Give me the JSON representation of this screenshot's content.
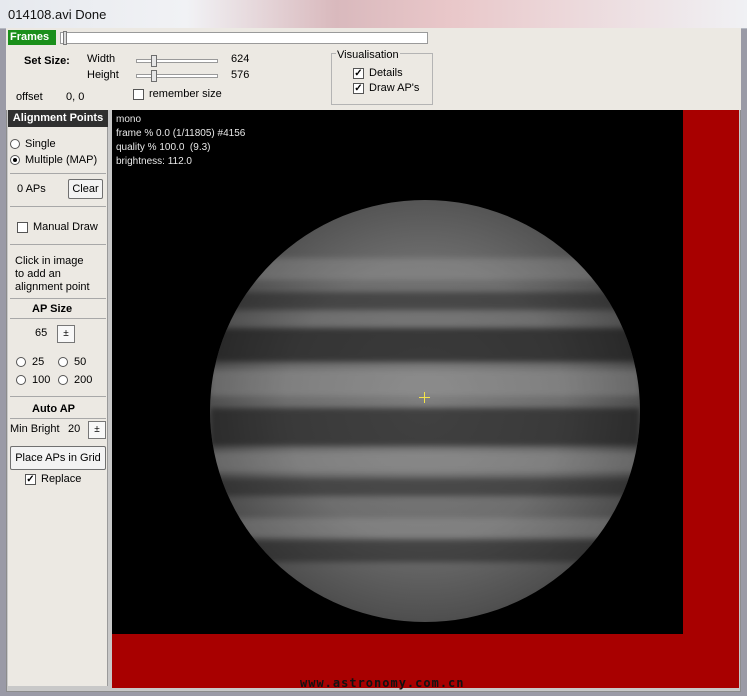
{
  "window": {
    "title": "014108.avi   Done"
  },
  "frames": {
    "label": "Frames",
    "position": 0.0
  },
  "set_size": {
    "label": "Set Size:",
    "width_label": "Width",
    "width_value": "624",
    "height_label": "Height",
    "height_value": "576",
    "offset_label": "offset",
    "offset_value": "0, 0",
    "remember_label": "remember size",
    "remember_checked": false
  },
  "visualisation": {
    "label": "Visualisation",
    "details_label": "Details",
    "details_checked": true,
    "draw_aps_label": "Draw AP's",
    "draw_aps_checked": true
  },
  "sidebar": {
    "title": "Alignment Points",
    "single_label": "Single",
    "multiple_label": "Multiple (MAP)",
    "mode": "multiple",
    "aps_count": "0 APs",
    "clear_label": "Clear",
    "manual_draw_label": "Manual Draw",
    "manual_draw_checked": false,
    "hint_line1": "Click in image",
    "hint_line2": "to add an",
    "hint_line3": "alignment point",
    "ap_size_title": "AP Size",
    "ap_size_value": "65",
    "size_options": [
      "25",
      "50",
      "100",
      "200"
    ],
    "auto_ap_title": "Auto AP",
    "min_bright_label": "Min Bright",
    "min_bright_value": "20",
    "place_grid_label": "Place APs in Grid",
    "replace_label": "Replace",
    "replace_checked": true
  },
  "image_info": {
    "line1": "mono",
    "line2": "frame % 0.0 (1/11805) #4156",
    "line3": "quality % 100.0  (9.3)",
    "line4": "brightness: 112.0"
  },
  "watermark": "www.astronomy.com.cn",
  "colors": {
    "frames_badge": "#1a8f1a",
    "image_border": "#a80000",
    "crosshair": "#f3e34a"
  }
}
